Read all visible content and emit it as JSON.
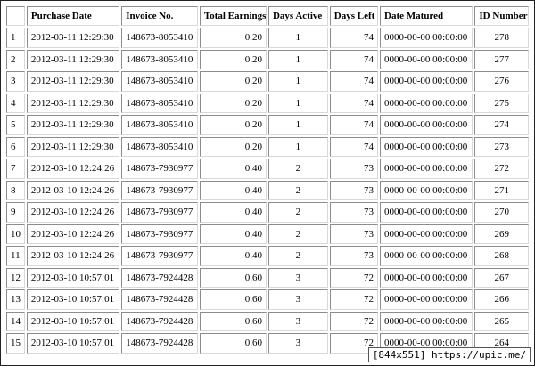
{
  "table": {
    "headers": [
      "",
      "Purchase Date",
      "Invoice No.",
      "Total Earnings",
      "Days Active",
      "Days Left",
      "Date Matured",
      "ID Number"
    ],
    "rows": [
      [
        "1",
        "2012-03-11 12:29:30",
        "148673-8053410",
        "0.20",
        "1",
        "74",
        "0000-00-00 00:00:00",
        "278"
      ],
      [
        "2",
        "2012-03-11 12:29:30",
        "148673-8053410",
        "0.20",
        "1",
        "74",
        "0000-00-00 00:00:00",
        "277"
      ],
      [
        "3",
        "2012-03-11 12:29:30",
        "148673-8053410",
        "0.20",
        "1",
        "74",
        "0000-00-00 00:00:00",
        "276"
      ],
      [
        "4",
        "2012-03-11 12:29:30",
        "148673-8053410",
        "0.20",
        "1",
        "74",
        "0000-00-00 00:00:00",
        "275"
      ],
      [
        "5",
        "2012-03-11 12:29:30",
        "148673-8053410",
        "0.20",
        "1",
        "74",
        "0000-00-00 00:00:00",
        "274"
      ],
      [
        "6",
        "2012-03-11 12:29:30",
        "148673-8053410",
        "0.20",
        "1",
        "74",
        "0000-00-00 00:00:00",
        "273"
      ],
      [
        "7",
        "2012-03-10 12:24:26",
        "148673-7930977",
        "0.40",
        "2",
        "73",
        "0000-00-00 00:00:00",
        "272"
      ],
      [
        "8",
        "2012-03-10 12:24:26",
        "148673-7930977",
        "0.40",
        "2",
        "73",
        "0000-00-00 00:00:00",
        "271"
      ],
      [
        "9",
        "2012-03-10 12:24:26",
        "148673-7930977",
        "0.40",
        "2",
        "73",
        "0000-00-00 00:00:00",
        "270"
      ],
      [
        "10",
        "2012-03-10 12:24:26",
        "148673-7930977",
        "0.40",
        "2",
        "73",
        "0000-00-00 00:00:00",
        "269"
      ],
      [
        "11",
        "2012-03-10 12:24:26",
        "148673-7930977",
        "0.40",
        "2",
        "73",
        "0000-00-00 00:00:00",
        "268"
      ],
      [
        "12",
        "2012-03-10 10:57:01",
        "148673-7924428",
        "0.60",
        "3",
        "72",
        "0000-00-00 00:00:00",
        "267"
      ],
      [
        "13",
        "2012-03-10 10:57:01",
        "148673-7924428",
        "0.60",
        "3",
        "72",
        "0000-00-00 00:00:00",
        "266"
      ],
      [
        "14",
        "2012-03-10 10:57:01",
        "148673-7924428",
        "0.60",
        "3",
        "72",
        "0000-00-00 00:00:00",
        "265"
      ],
      [
        "15",
        "2012-03-10 10:57:01",
        "148673-7924428",
        "0.60",
        "3",
        "72",
        "0000-00-00 00:00:00",
        "264"
      ]
    ]
  },
  "watermark": "[844x551] https://upic.me/"
}
